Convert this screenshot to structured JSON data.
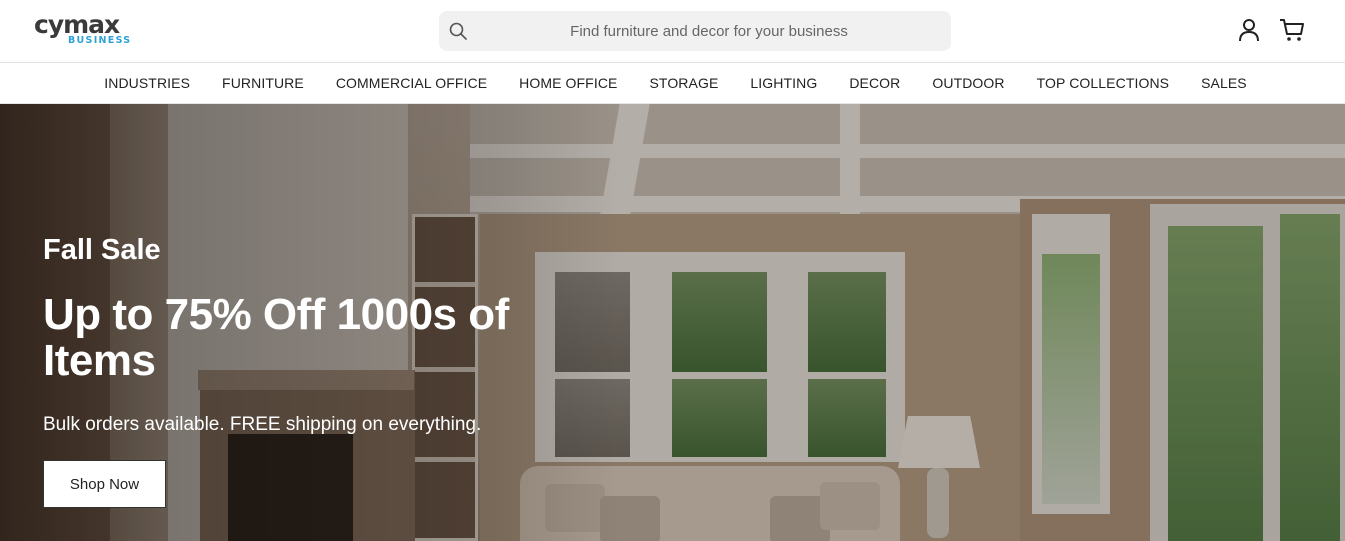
{
  "brand": {
    "name": "cymax",
    "sub": "BUSINESS",
    "accent_color": "#2fa1d6"
  },
  "search": {
    "placeholder": "Find furniture and decor for your business",
    "icon": "search-icon"
  },
  "header_icons": {
    "account": "user-icon",
    "cart": "shopping-cart-icon"
  },
  "nav": {
    "items": [
      "INDUSTRIES",
      "FURNITURE",
      "COMMERCIAL OFFICE",
      "HOME OFFICE",
      "STORAGE",
      "LIGHTING",
      "DECOR",
      "OUTDOOR",
      "TOP COLLECTIONS",
      "SALES"
    ]
  },
  "hero": {
    "eyebrow": "Fall Sale",
    "headline": "Up to 75% Off 1000s of Items",
    "subtext": "Bulk orders available. FREE shipping on everything.",
    "cta_label": "Shop Now"
  }
}
